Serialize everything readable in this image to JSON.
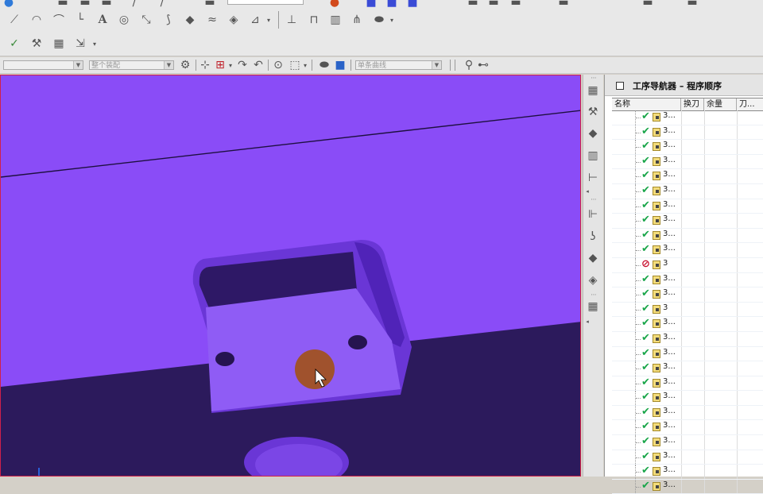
{
  "navigator": {
    "title": "工序导航器 – 程序顺序",
    "columns": [
      "名称",
      "换刀",
      "余量",
      "刀..."
    ],
    "rows": [
      {
        "status": "check-icon",
        "label": "3..."
      },
      {
        "status": "check-icon",
        "label": "3..."
      },
      {
        "status": "check-icon",
        "label": "3..."
      },
      {
        "status": "check-icon",
        "label": "3..."
      },
      {
        "status": "check-icon",
        "label": "3..."
      },
      {
        "status": "check-icon",
        "label": "3..."
      },
      {
        "status": "check-icon",
        "label": "3..."
      },
      {
        "status": "check-icon",
        "label": "3..."
      },
      {
        "status": "check-icon",
        "label": "3..."
      },
      {
        "status": "check-icon",
        "label": "3..."
      },
      {
        "status": "blocked-icon",
        "label": "3"
      },
      {
        "status": "check-icon",
        "label": "3..."
      },
      {
        "status": "check-icon",
        "label": "3..."
      },
      {
        "status": "check-icon",
        "label": "3"
      },
      {
        "status": "check-icon",
        "label": "3..."
      },
      {
        "status": "check-icon",
        "label": "3..."
      },
      {
        "status": "check-icon",
        "label": "3..."
      },
      {
        "status": "check-icon",
        "label": "3..."
      },
      {
        "status": "check-icon",
        "label": "3..."
      },
      {
        "status": "check-icon",
        "label": "3..."
      },
      {
        "status": "check-icon",
        "label": "3..."
      },
      {
        "status": "check-icon",
        "label": "3..."
      },
      {
        "status": "check-icon",
        "label": "3..."
      },
      {
        "status": "check-icon",
        "label": "3..."
      },
      {
        "status": "check-icon",
        "label": "3..."
      },
      {
        "status": "check-icon",
        "label": "3..."
      }
    ]
  },
  "toolbar": {
    "filter_dropdown_1": "",
    "filter_dropdown_2": "整个装配",
    "filter_dropdown_3": "单条曲线"
  },
  "colors": {
    "viewport_bg": "#8a4cf7",
    "dark_surface": "#2c1a5c",
    "part_face": "#6a36d6",
    "cursor_highlight": "#a0522d",
    "check": "#1aa64a",
    "blocked": "#c8102e"
  }
}
